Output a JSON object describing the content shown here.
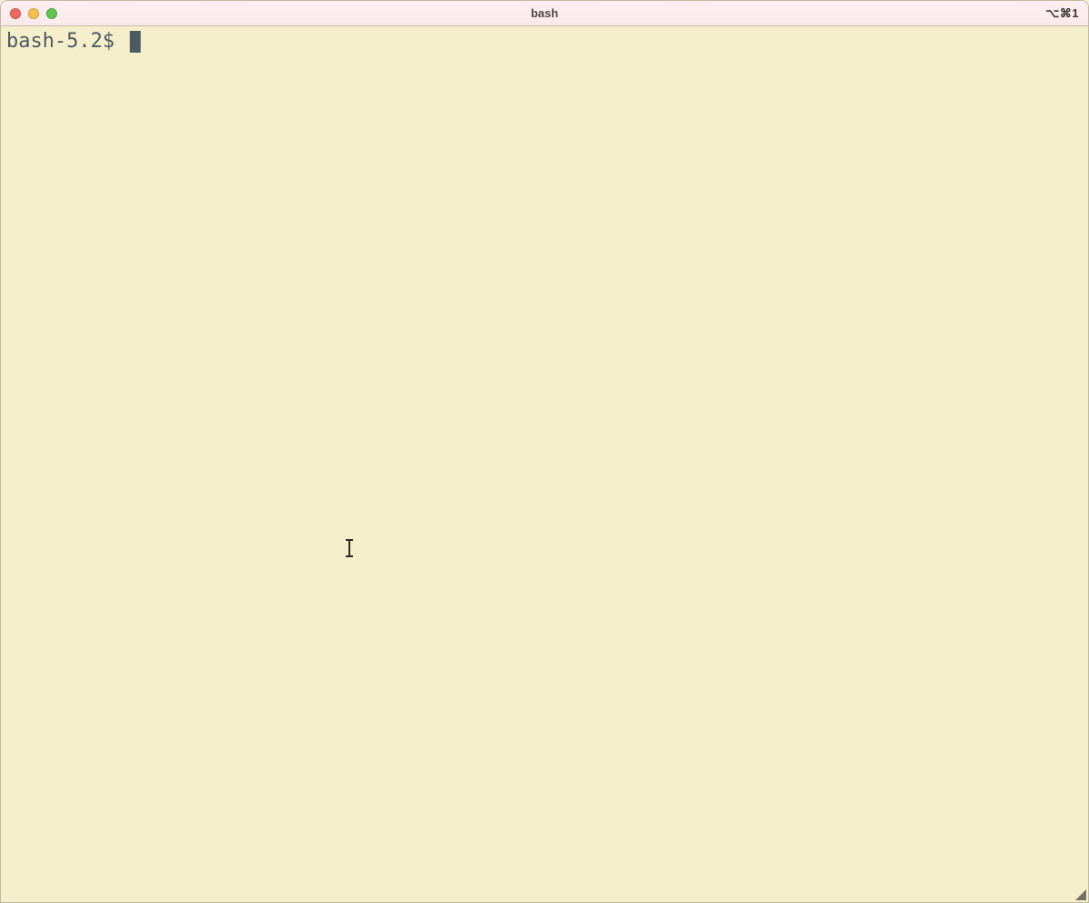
{
  "window": {
    "title": "bash",
    "shortcut_indicator": "⌥⌘1"
  },
  "terminal": {
    "prompt": "bash-5.2$ ",
    "input": ""
  }
}
